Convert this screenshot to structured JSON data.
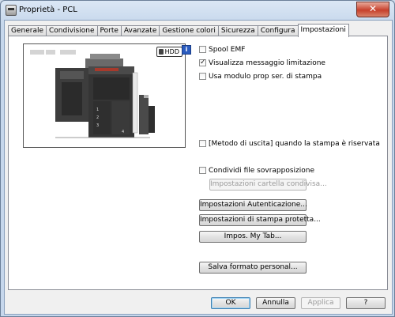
{
  "window": {
    "title": "Proprietà - PCL",
    "close_symbol": "✕"
  },
  "tabs": [
    {
      "label": "Generale"
    },
    {
      "label": "Condivisione"
    },
    {
      "label": "Porte"
    },
    {
      "label": "Avanzate"
    },
    {
      "label": "Gestione colori"
    },
    {
      "label": "Sicurezza"
    },
    {
      "label": "Configura"
    },
    {
      "label": "Impostazioni",
      "active": true
    }
  ],
  "preview": {
    "badge": "HDD"
  },
  "info_glyph": "i",
  "options": {
    "spool_emf": {
      "label": "Spool EMF",
      "checked": false
    },
    "show_limit_message": {
      "label": "Visualizza messaggio limitazione",
      "checked": true
    },
    "use_prop_module": {
      "label": "Usa modulo prop ser. di stampa",
      "checked": false
    },
    "output_method": {
      "label": "[Metodo di uscita] quando la stampa è riservata",
      "checked": false
    },
    "share_overlay": {
      "label": "Condividi file sovrapposizione",
      "checked": false
    }
  },
  "buttons": {
    "shared_folder": "Impostazioni cartella condivisa...",
    "auth": "Impostazioni Autenticazione...",
    "protected_print": "Impostazioni di stampa protetta...",
    "my_tab": "Impos. My Tab...",
    "save_format": "Salva formato personal...",
    "ok": "OK",
    "cancel": "Annulla",
    "apply": "Applica",
    "help": "?"
  }
}
